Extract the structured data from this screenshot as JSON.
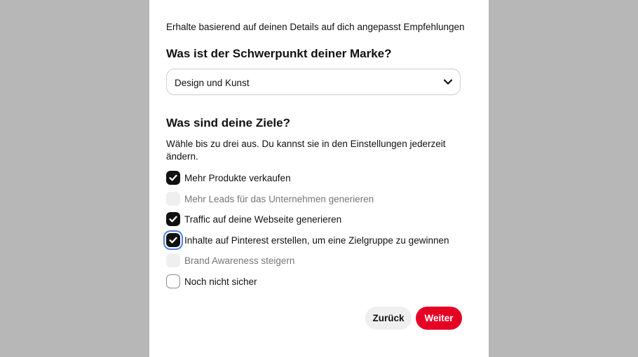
{
  "intro_text": "Erhalte basierend auf deinen Details auf dich angepasst Empfehlungen",
  "brand_focus": {
    "question": "Was ist der Schwerpunkt deiner Marke?",
    "selected_value": "Design und Kunst",
    "icon": "chevron-down-icon"
  },
  "goals": {
    "question": "Was sind deine Ziele?",
    "hint": "Wähle bis zu drei aus. Du kannst sie in den Einstellungen jederzeit ändern.",
    "options": [
      {
        "label": "Mehr Produkte verkaufen",
        "state": "checked"
      },
      {
        "label": "Mehr Leads für das Unternehmen generieren",
        "state": "disabled"
      },
      {
        "label": "Traffic auf deine Webseite generieren",
        "state": "checked"
      },
      {
        "label": "Inhalte auf Pinterest erstellen, um eine Zielgruppe zu gewinnen",
        "state": "checked-focused"
      },
      {
        "label": "Brand Awareness steigern",
        "state": "disabled"
      },
      {
        "label": "Noch nicht sicher",
        "state": "unchecked"
      }
    ]
  },
  "buttons": {
    "back_label": "Zurück",
    "next_label": "Weiter"
  },
  "colors": {
    "accent": "#e60023",
    "checkbox_checked": "#111111",
    "focus_ring": "#4f85d6",
    "backdrop": "#b7b7b7"
  }
}
